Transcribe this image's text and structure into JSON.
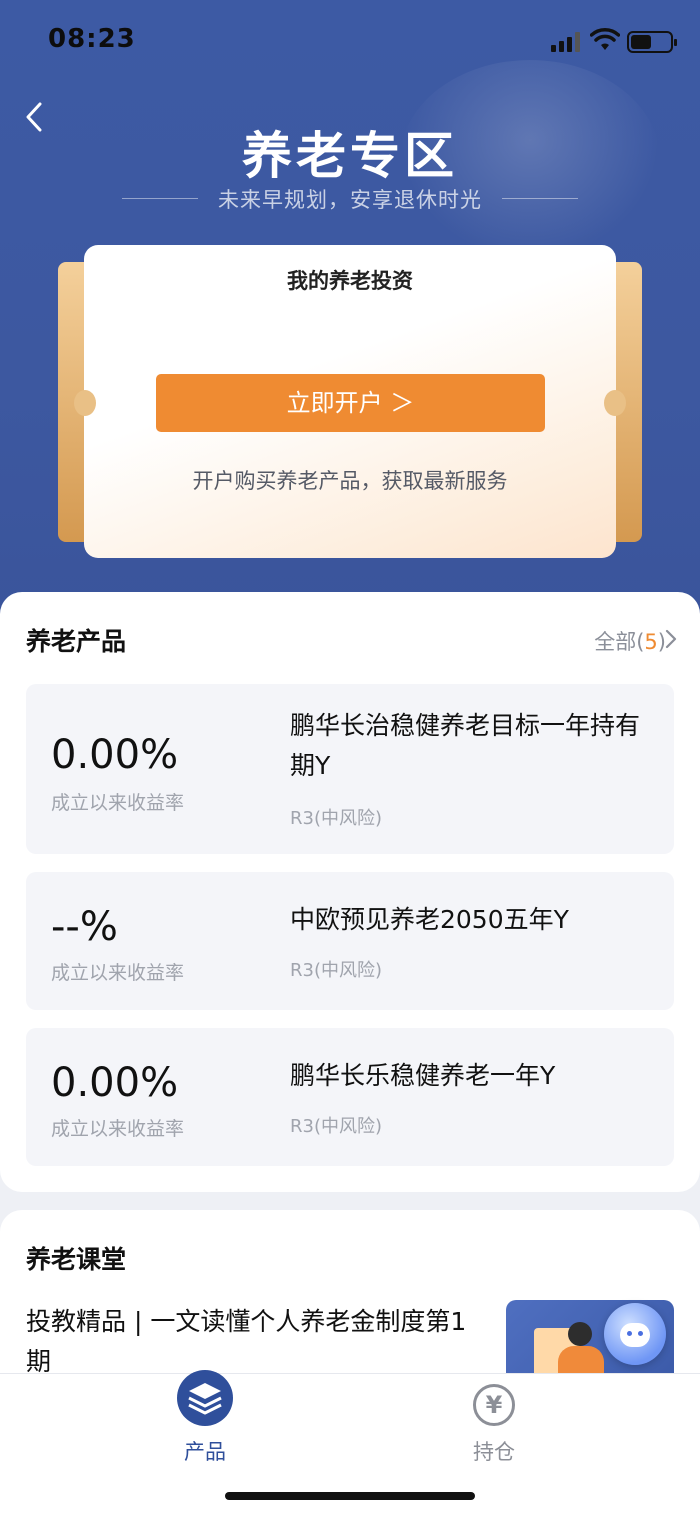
{
  "status_bar": {
    "time": "08:23"
  },
  "header": {
    "title": "养老专区",
    "subtitle": "未来早规划，安享退休时光"
  },
  "invest_card": {
    "title": "我的养老投资",
    "open_button": "立即开户 ＞",
    "description": "开户购买养老产品，获取最新服务"
  },
  "products": {
    "title": "养老产品",
    "all_prefix": "全部(",
    "all_count": "5",
    "all_suffix": ")",
    "items": [
      {
        "rate": "0.00%",
        "rate_label": "成立以来收益率",
        "name": "鹏华长治稳健养老目标一年持有期Y",
        "risk": "R3(中风险)"
      },
      {
        "rate": "--%",
        "rate_label": "成立以来收益率",
        "name": "中欧预见养老2050五年Y",
        "risk": "R3(中风险)"
      },
      {
        "rate": "0.00%",
        "rate_label": "成立以来收益率",
        "name": "鹏华长乐稳健养老一年Y",
        "risk": "R3(中风险)"
      }
    ]
  },
  "classroom": {
    "title": "养老课堂",
    "article": "投教精品 | 一文读懂个人养老金制度第1期"
  },
  "tabbar": {
    "tabs": [
      {
        "label": "产品",
        "icon": "layers-icon",
        "active": true
      },
      {
        "label": "持仓",
        "icon": "yen-icon",
        "active": false
      }
    ],
    "active_color": "#2f4f9b",
    "inactive_color": "#8c8f97"
  },
  "colors": {
    "hero_blue": "#3d5aa4",
    "accent_orange": "#ef8b32"
  }
}
